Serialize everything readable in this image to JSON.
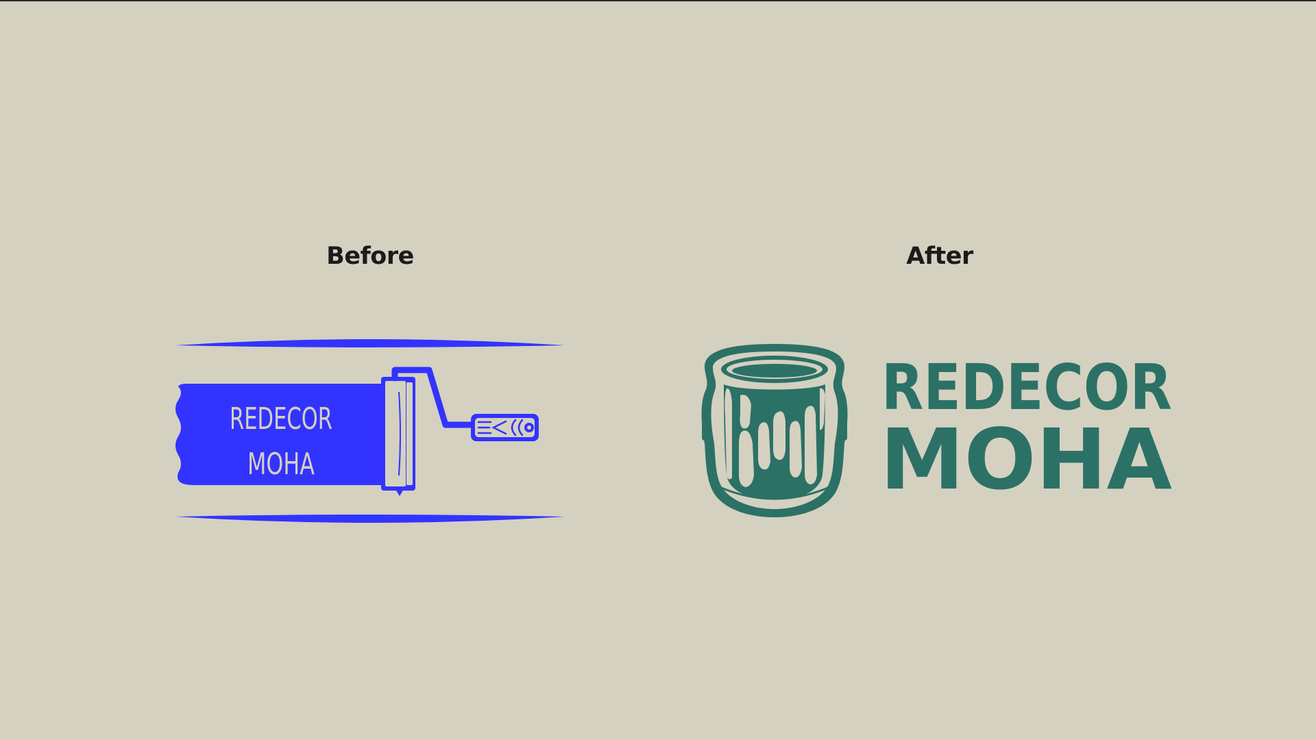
{
  "labels": {
    "before": "Before",
    "after": "After"
  },
  "before_logo": {
    "line1": "REDECOR",
    "line2": "MOHA",
    "color": "#3333ff"
  },
  "after_logo": {
    "line1": "REDECOR",
    "line2": "MOHA",
    "color": "#2c7166"
  },
  "colors": {
    "background": "#d4d1c0",
    "label_text": "#1b1b1b"
  }
}
